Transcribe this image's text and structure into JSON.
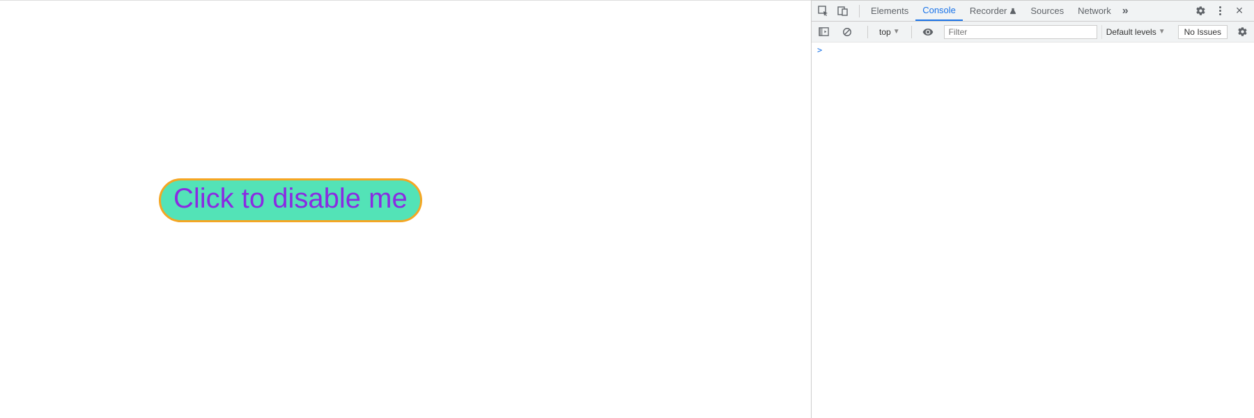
{
  "page": {
    "button_label": "Click to disable me"
  },
  "devtools": {
    "tabs": {
      "elements": "Elements",
      "console": "Console",
      "recorder": "Recorder",
      "sources": "Sources",
      "network": "Network"
    },
    "subbar": {
      "context": "top",
      "filter_placeholder": "Filter",
      "levels": "Default levels",
      "issues": "No Issues"
    },
    "console": {
      "prompt": ">"
    }
  }
}
